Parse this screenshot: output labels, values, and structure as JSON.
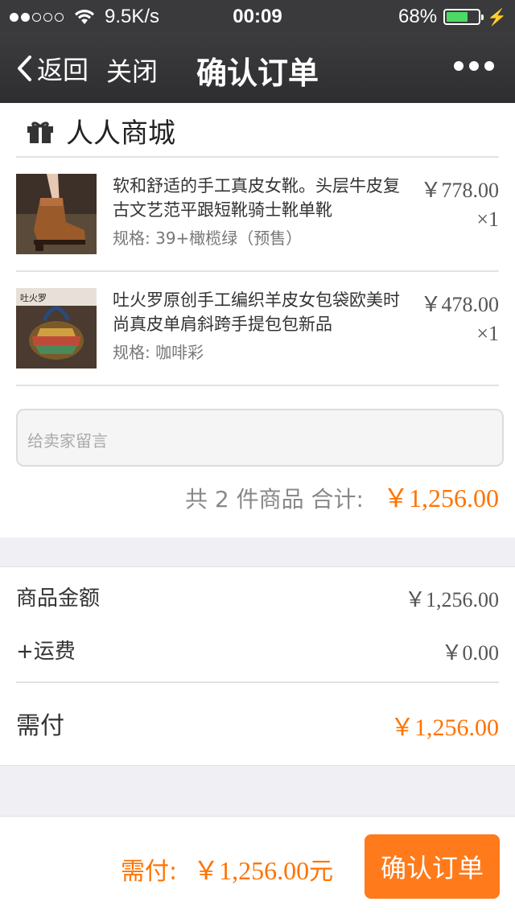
{
  "status_bar": {
    "network_speed": "9.5K/s",
    "time": "00:09",
    "battery_percent": "68%",
    "battery_level": 0.68,
    "signal_bars_filled": 2,
    "signal_bars_total": 5
  },
  "nav": {
    "back_label": "返回",
    "close_label": "关闭",
    "title": "确认订单"
  },
  "shop": {
    "name": "人人商城",
    "icon": "gift-icon"
  },
  "items": [
    {
      "title": "软和舒适的手工真皮女靴。头层牛皮复古文艺范平跟短靴骑士靴单靴",
      "spec": "规格: 39+橄榄绿（预售）",
      "price": "￥778.00",
      "qty": "×1"
    },
    {
      "title": "吐火罗原创手工编织羊皮女包袋欧美时尚真皮单肩斜跨手提包包新品",
      "spec": "规格: 咖啡彩",
      "price": "￥478.00",
      "qty": "×1",
      "thumb_badge": "吐火罗"
    }
  ],
  "message": {
    "placeholder": "给卖家留言"
  },
  "order_total": {
    "label": "共 2 件商品  合计:",
    "amount": "￥1,256.00"
  },
  "summary": {
    "goods_label": "商品金额",
    "goods_value": "￥1,256.00",
    "shipping_label": "+运费",
    "shipping_value": "￥0.00",
    "due_label": "需付",
    "due_value": "￥1,256.00"
  },
  "bottom_bar": {
    "pay_label": "需付:",
    "pay_amount": "￥1,256.00",
    "pay_unit": "元",
    "confirm_label": "确认订单"
  },
  "colors": {
    "accent": "#ff7300",
    "header_bg": "#3a3a3c",
    "battery": "#4cd964"
  }
}
